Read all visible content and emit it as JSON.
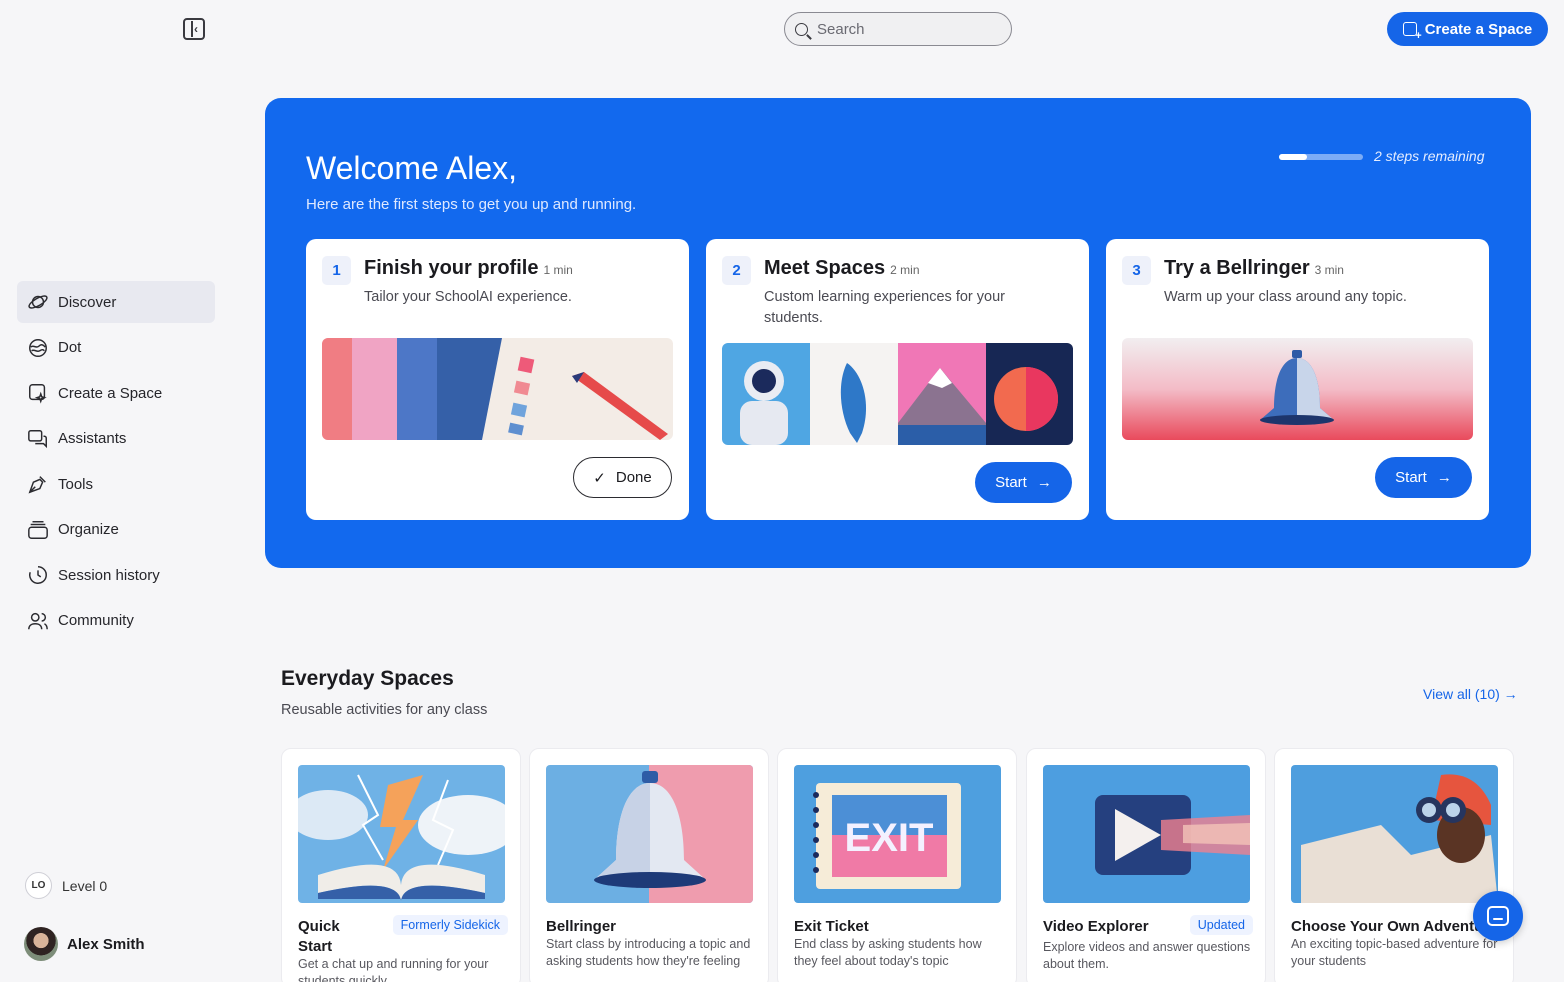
{
  "topbar": {
    "search_placeholder": "Search",
    "create_label": "Create a Space"
  },
  "sidebar": {
    "items": [
      {
        "label": "Discover",
        "icon": "planet-icon",
        "active": true
      },
      {
        "label": "Dot",
        "icon": "dot-icon"
      },
      {
        "label": "Create a Space",
        "icon": "create-space-icon"
      },
      {
        "label": "Assistants",
        "icon": "chat-bubbles-icon"
      },
      {
        "label": "Tools",
        "icon": "pen-tool-icon"
      },
      {
        "label": "Organize",
        "icon": "stack-icon"
      },
      {
        "label": "Session history",
        "icon": "history-clock-icon"
      },
      {
        "label": "Community",
        "icon": "people-icon"
      }
    ],
    "level_badge": "LO",
    "level_label": "Level 0",
    "user_name": "Alex Smith"
  },
  "hero": {
    "title": "Welcome Alex,",
    "subtitle": "Here are the first steps to get you up and running.",
    "progress_fraction": 0.33,
    "steps_remaining": "2 steps remaining",
    "steps": [
      {
        "num": "1",
        "title": "Finish your profile",
        "time": "1 min",
        "desc": "Tailor your SchoolAI experience.",
        "button": "Done"
      },
      {
        "num": "2",
        "title": "Meet Spaces",
        "time": "2 min",
        "desc": "Custom learning experiences for your students.",
        "button": "Start"
      },
      {
        "num": "3",
        "title": "Try a Bellringer",
        "time": "3 min",
        "desc": "Warm up your class around any topic.",
        "button": "Start"
      }
    ]
  },
  "everyday": {
    "title": "Everyday Spaces",
    "subtitle": "Reusable activities for any class",
    "view_all": "View all (10) →",
    "cards": [
      {
        "title": "Quick Start",
        "tag": "Formerly Sidekick",
        "desc": "Get a chat up and running for your students quickly"
      },
      {
        "title": "Bellringer",
        "tag": "",
        "desc": "Start class by introducing a topic and asking students how they're feeling"
      },
      {
        "title": "Exit Ticket",
        "tag": "",
        "desc": "End class by asking students how they feel about today's topic",
        "img_text": "EXIT"
      },
      {
        "title": "Video Explorer",
        "tag": "Updated",
        "desc": "Explore videos and answer questions about them."
      },
      {
        "title": "Choose Your Own Adventure",
        "tag": "",
        "desc": "An exciting topic-based adventure for your students"
      }
    ]
  },
  "colors": {
    "accent": "#1565e8",
    "hero_bg": "#1269ee",
    "page_bg": "#f6f6f8"
  }
}
